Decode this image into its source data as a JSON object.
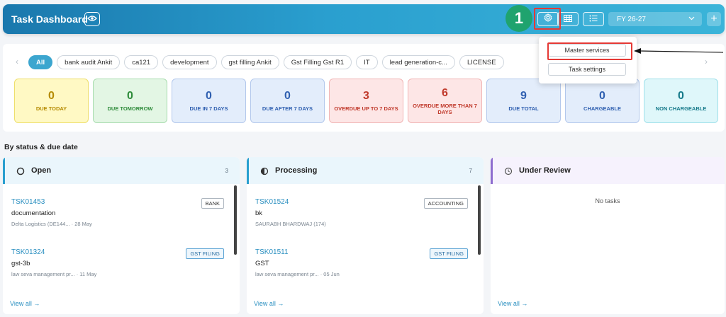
{
  "header": {
    "title": "Task Dashboard",
    "step_badge": "1",
    "fy_selected": "FY 26-27",
    "plus_label": "+"
  },
  "settings_menu": {
    "items": [
      "Master services",
      "Task settings"
    ]
  },
  "filters": {
    "chips": [
      "All",
      "bank audit Ankit",
      "ca121",
      "development",
      "gst filling Ankit",
      "Gst Filling Gst R1",
      "IT",
      "lead generation-c...",
      "LICENSE"
    ]
  },
  "stats": [
    {
      "value": "0",
      "label": "DUE TODAY",
      "color": "#b58a00",
      "bg": "#fff9c4",
      "border": "#eedf6c"
    },
    {
      "value": "0",
      "label": "DUE TOMORROW",
      "color": "#2e8b3a",
      "bg": "#e3f6e4",
      "border": "#a8dcae"
    },
    {
      "value": "0",
      "label": "DUE IN 7 DAYS",
      "color": "#2f5fb0",
      "bg": "#e3edfb",
      "border": "#b3c8ec"
    },
    {
      "value": "0",
      "label": "DUE AFTER 7 DAYS",
      "color": "#2f5fb0",
      "bg": "#e3edfb",
      "border": "#b3c8ec"
    },
    {
      "value": "3",
      "label": "OVERDUE UP TO 7 DAYS",
      "color": "#c0392b",
      "bg": "#fde6e6",
      "border": "#f1b5b5"
    },
    {
      "value": "6",
      "label": "OVERDUE MORE THAN 7 DAYS",
      "color": "#c0392b",
      "bg": "#fde6e6",
      "border": "#f1b5b5"
    },
    {
      "value": "9",
      "label": "DUE TOTAL",
      "color": "#2f5fb0",
      "bg": "#e3edfb",
      "border": "#b3c8ec"
    },
    {
      "value": "0",
      "label": "CHARGEABLE",
      "color": "#2f5fb0",
      "bg": "#e3edfb",
      "border": "#b3c8ec"
    },
    {
      "value": "0",
      "label": "NON CHARGEABLE",
      "color": "#167a8a",
      "bg": "#dff7fa",
      "border": "#9fe0ea"
    }
  ],
  "section_title": "By status & due date",
  "columns": [
    {
      "name": "Open",
      "count": "3",
      "accent": "#2a9fcf",
      "head_bg": "#eaf6fc",
      "icon": "circle-outline-icon",
      "tasks": [
        {
          "id": "TSK01453",
          "title": "documentation",
          "meta": "Delta Logistics (DE144... · 28 May",
          "tag": "BANK",
          "tag_style": "plain"
        },
        {
          "id": "TSK01324",
          "title": "gst-3b",
          "meta": "law seva management pr... · 11 May",
          "tag": "GST FILING",
          "tag_style": "gst"
        }
      ],
      "view_all": "View all →",
      "empty_text": ""
    },
    {
      "name": "Processing",
      "count": "7",
      "accent": "#2a9fcf",
      "head_bg": "#eaf6fc",
      "icon": "half-circle-icon",
      "tasks": [
        {
          "id": "TSK01524",
          "title": "bk",
          "meta": "SAURABH BHARDWAJ (174)",
          "tag": "ACCOUNTING",
          "tag_style": "plain"
        },
        {
          "id": "TSK01511",
          "title": "GST",
          "meta": "law seva management pr... · 05 Jun",
          "tag": "GST FILING",
          "tag_style": "gst"
        }
      ],
      "view_all": "View all →",
      "empty_text": ""
    },
    {
      "name": "Under Review",
      "count": "",
      "accent": "#8e6ccf",
      "head_bg": "#f6f2fd",
      "icon": "clock-icon",
      "tasks": [],
      "view_all": "View all →",
      "empty_text": "No tasks"
    }
  ]
}
